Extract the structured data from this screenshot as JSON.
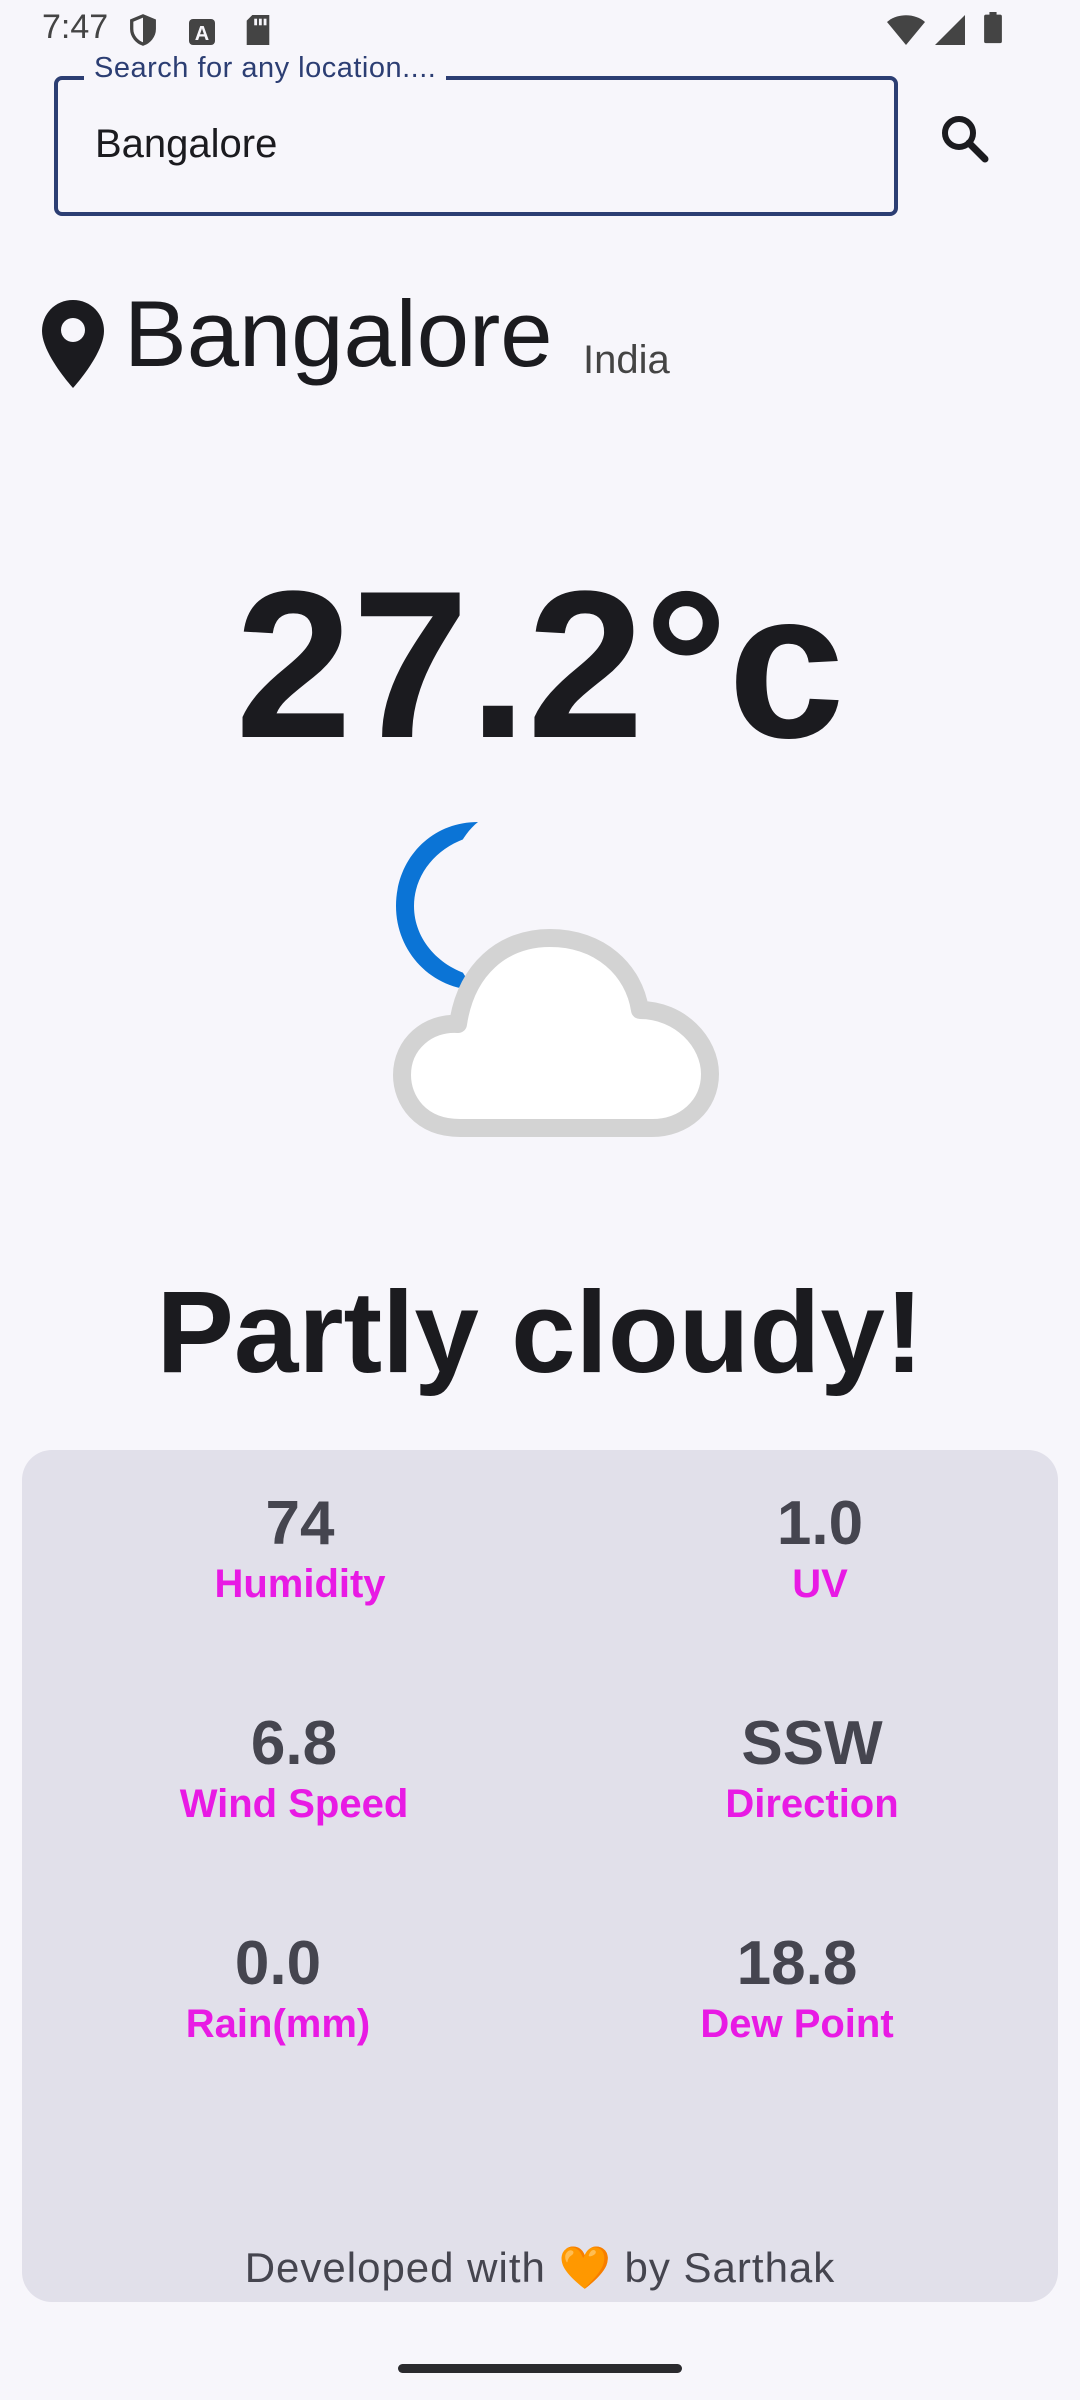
{
  "status_bar": {
    "time": "7:47",
    "icons": [
      "shield-icon",
      "text-a-icon",
      "sd-card-icon",
      "wifi-icon",
      "signal-icon",
      "battery-icon"
    ]
  },
  "search": {
    "label": "Search for any location....",
    "value": "Bangalore",
    "button_icon": "search-icon"
  },
  "location": {
    "icon": "location-pin-icon",
    "city": "Bangalore",
    "country": "India"
  },
  "weather": {
    "temperature": "27.2°c",
    "icon": "partly-cloudy-night-icon",
    "condition": "Partly cloudy!"
  },
  "stats": [
    {
      "value": "74",
      "label": "Humidity"
    },
    {
      "value": "1.0",
      "label": "UV"
    },
    {
      "value": "6.8",
      "label": "Wind Speed"
    },
    {
      "value": "SSW",
      "label": "Direction"
    },
    {
      "value": "0.0",
      "label": "Rain(mm)"
    },
    {
      "value": "18.8",
      "label": "Dew Point"
    }
  ],
  "footer": {
    "prefix": "Developed with",
    "heart": "🧡",
    "suffix": "by Sarthak"
  },
  "colors": {
    "accent": "#2c3e73",
    "stat_label": "#e81ae4",
    "card_bg": "#e1e0ea",
    "page_bg": "#f7f6fb",
    "moon": "#0b74d6"
  }
}
